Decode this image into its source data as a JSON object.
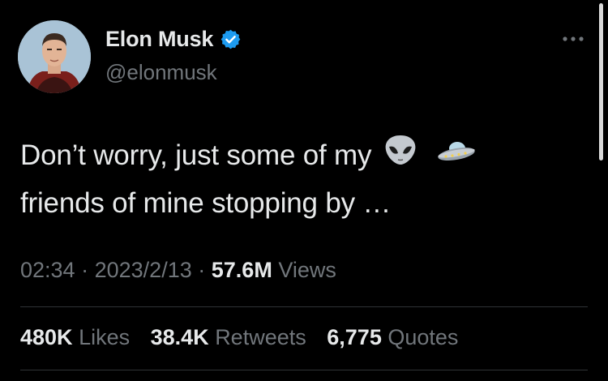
{
  "author": {
    "name": "Elon Musk",
    "handle": "@elonmusk"
  },
  "tweet": {
    "line1": "Don’t worry, just some of my",
    "line2": "friends of mine stopping by …",
    "emojis": [
      "alien-emoji",
      "flying-saucer-emoji"
    ]
  },
  "meta": {
    "time": "02:34",
    "sep1": "·",
    "date": "2023/2/13",
    "sep2": "·",
    "views_count": "57.6M",
    "views_label": "Views"
  },
  "stats": {
    "likes_count": "480K",
    "likes_label": "Likes",
    "retweets_count": "38.4K",
    "retweets_label": "Retweets",
    "quotes_count": "6,775",
    "quotes_label": "Quotes"
  },
  "colors": {
    "background": "#000000",
    "primary_text": "#e7e9ea",
    "secondary_text": "#71767b",
    "verified_blue": "#1d9bf0",
    "divider": "#2f3336"
  }
}
